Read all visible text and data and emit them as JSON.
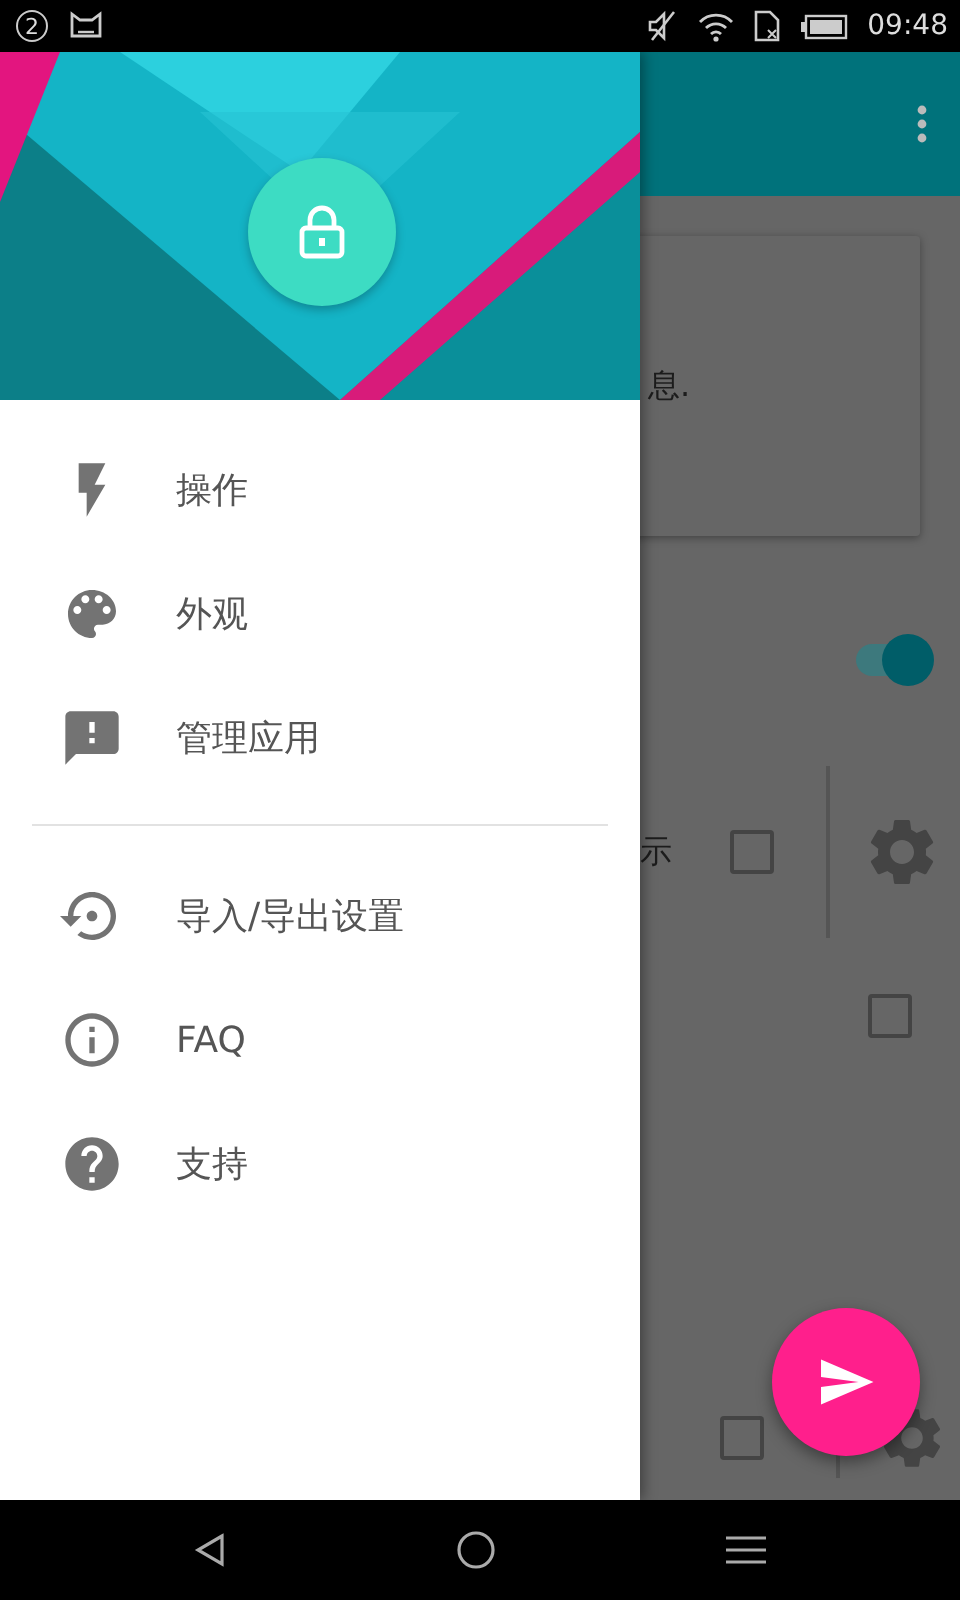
{
  "status_bar": {
    "notification_count": "2",
    "time": "09:48"
  },
  "background": {
    "card_text": "息.",
    "switch": {
      "on": true
    },
    "row_text": "示",
    "row_checkbox": {
      "checked": false
    },
    "checkbox": {
      "checked": false
    },
    "partial_checkbox": {
      "checked": false
    }
  },
  "drawer": {
    "sections": [
      [
        {
          "label": "操作"
        },
        {
          "label": "外观"
        },
        {
          "label": "管理应用"
        }
      ],
      [
        {
          "label": "导入/导出设置"
        },
        {
          "label": "FAQ"
        },
        {
          "label": "支持"
        }
      ]
    ]
  }
}
